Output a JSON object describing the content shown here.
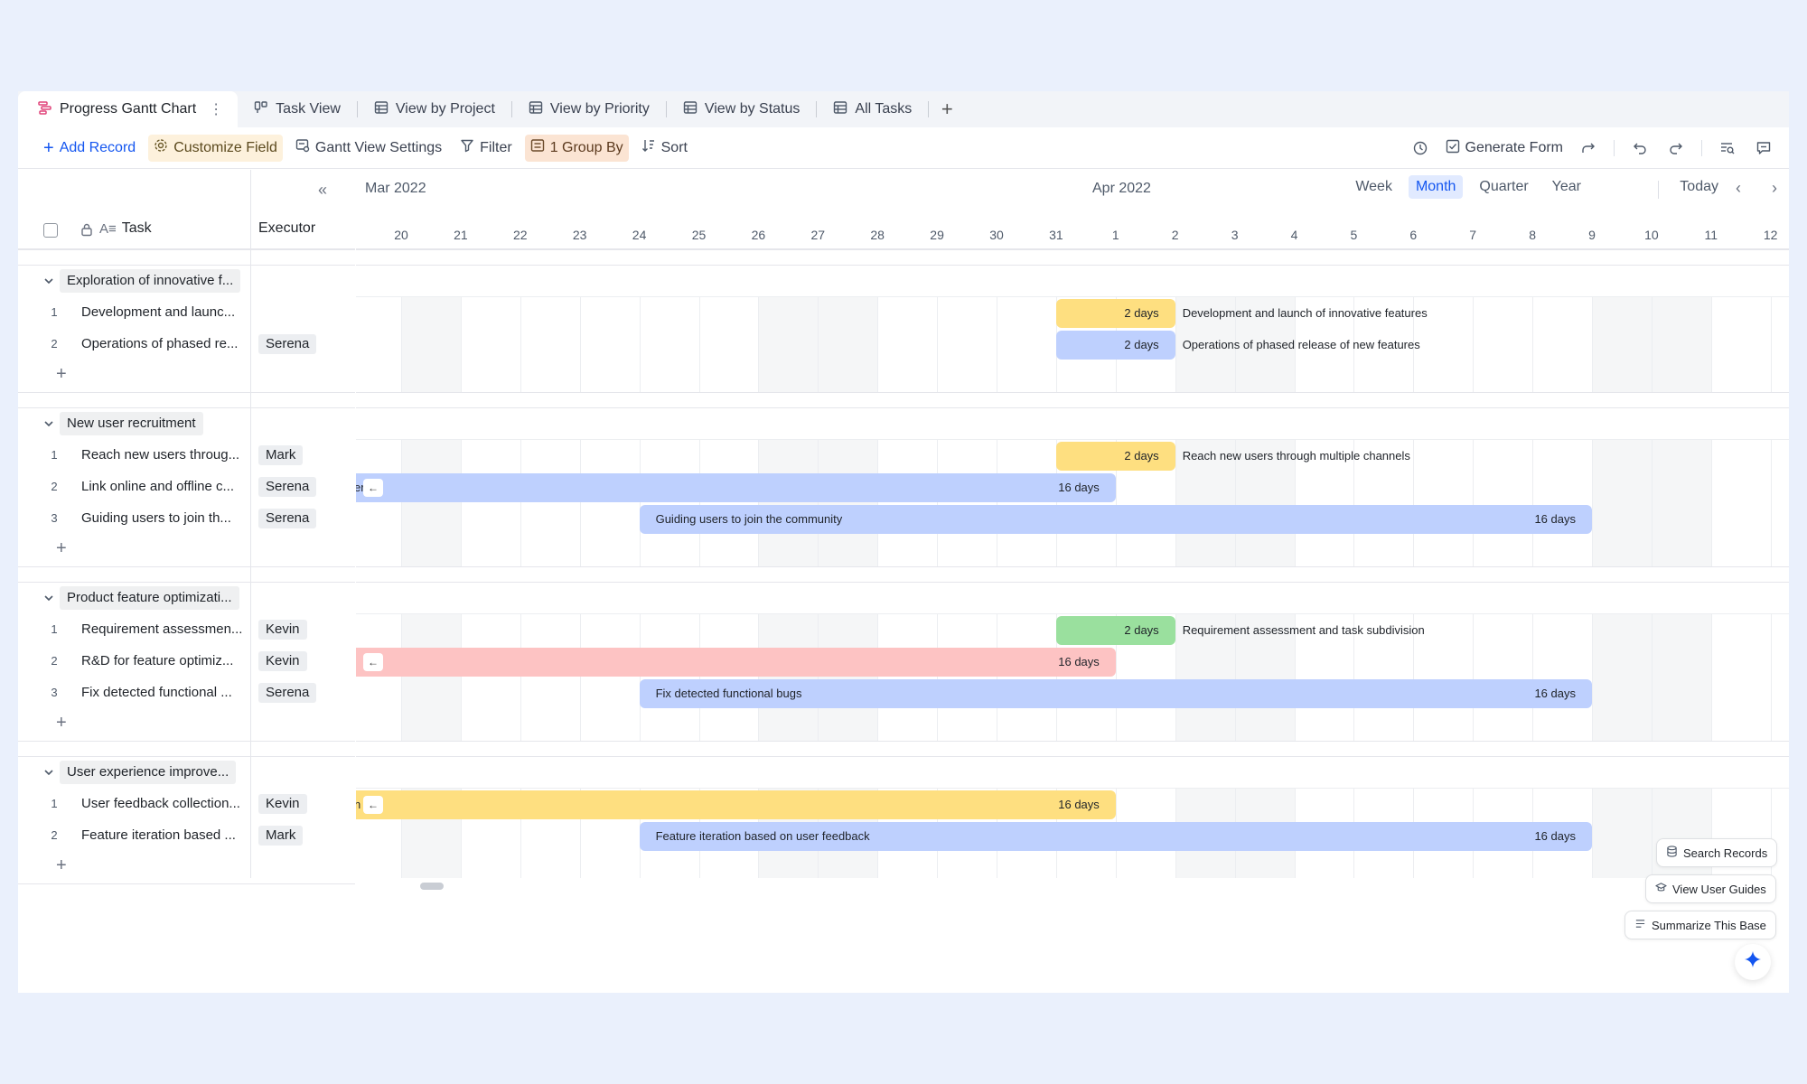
{
  "tabs": [
    {
      "label": "Progress Gantt Chart",
      "icon": "gantt-icon",
      "active": true
    },
    {
      "label": "Task View",
      "icon": "kanban-icon"
    },
    {
      "label": "View by Project",
      "icon": "grid-icon"
    },
    {
      "label": "View by Priority",
      "icon": "grid-icon"
    },
    {
      "label": "View by Status",
      "icon": "grid-icon"
    },
    {
      "label": "All Tasks",
      "icon": "grid-icon"
    }
  ],
  "toolbar": {
    "add_record": "Add Record",
    "customize_field": "Customize Field",
    "gantt_settings": "Gantt View Settings",
    "filter": "Filter",
    "group_by": "1 Group By",
    "sort": "Sort",
    "generate_form": "Generate Form"
  },
  "header": {
    "task_col": "Task",
    "executor_col": "Executor",
    "month_left": "Mar 2022",
    "month_right": "Apr 2022",
    "scales": [
      "Week",
      "Month",
      "Quarter",
      "Year"
    ],
    "active_scale": "Month",
    "today": "Today",
    "days": [
      "20",
      "21",
      "22",
      "23",
      "24",
      "25",
      "26",
      "27",
      "28",
      "29",
      "30",
      "31",
      "1",
      "2",
      "3",
      "4",
      "5",
      "6",
      "7",
      "8",
      "9",
      "10",
      "11",
      "12"
    ]
  },
  "groups": [
    {
      "name": "Exploration of innovative f...",
      "rows": [
        {
          "num": "1",
          "task": "Development and launc...",
          "executor": "",
          "days": "2 days",
          "label": "Development and launch of innovative features"
        },
        {
          "num": "2",
          "task": "Operations of phased re...",
          "executor": "Serena",
          "days": "2 days",
          "label": "Operations of phased release of new features"
        }
      ]
    },
    {
      "name": "New user recruitment",
      "rows": [
        {
          "num": "1",
          "task": "Reach new users throug...",
          "executor": "Mark",
          "days": "2 days",
          "label": "Reach new users through multiple channels"
        },
        {
          "num": "2",
          "task": "Link online and offline c...",
          "executor": "Serena",
          "days": "16 days",
          "label": "er"
        },
        {
          "num": "3",
          "task": "Guiding users to join th...",
          "executor": "Serena",
          "days": "16 days",
          "label": "Guiding users to join the community"
        }
      ]
    },
    {
      "name": "Product feature optimizati...",
      "rows": [
        {
          "num": "1",
          "task": "Requirement assessmen...",
          "executor": "Kevin",
          "days": "2 days",
          "label": "Requirement assessment and task subdivision"
        },
        {
          "num": "2",
          "task": "R&D for feature optimiz...",
          "executor": "Kevin",
          "days": "16 days",
          "label": ""
        },
        {
          "num": "3",
          "task": "Fix detected functional ...",
          "executor": "Serena",
          "days": "16 days",
          "label": "Fix detected functional bugs"
        }
      ]
    },
    {
      "name": "User experience improve...",
      "rows": [
        {
          "num": "1",
          "task": "User feedback collection...",
          "executor": "Kevin",
          "days": "16 days",
          "label": "n"
        },
        {
          "num": "2",
          "task": "Feature iteration based ...",
          "executor": "Mark",
          "days": "16 days",
          "label": "Feature iteration based on user feedback"
        }
      ]
    }
  ],
  "floating": {
    "search_records": "Search Records",
    "view_user_guides": "View User Guides",
    "summarize": "Summarize This Base"
  },
  "colors": {
    "accent": "#1456f0",
    "bar_yellow": "#fedf80",
    "bar_blue": "#bed0fe",
    "bar_green": "#9ae09e",
    "bar_red": "#fdc3c3"
  }
}
